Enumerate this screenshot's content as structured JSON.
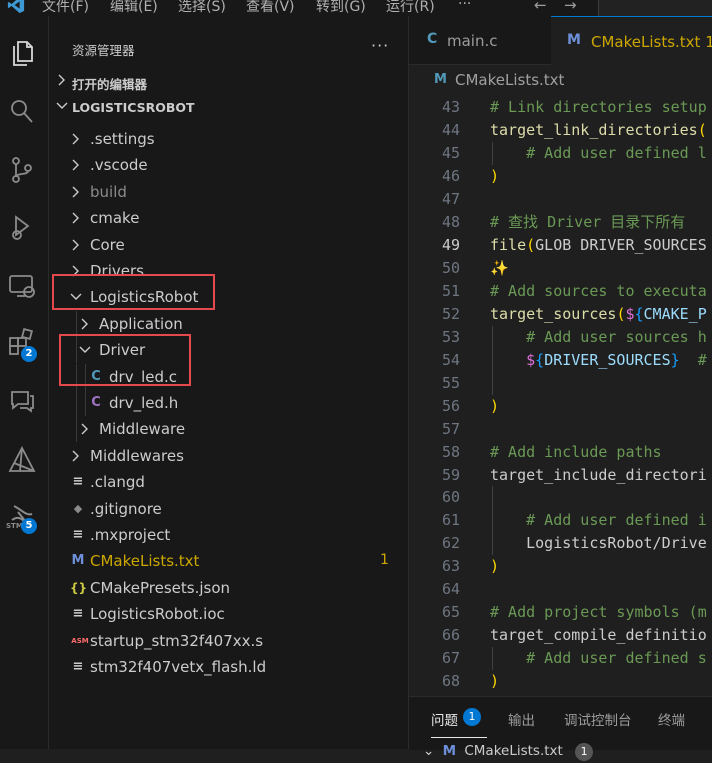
{
  "menubar": {
    "items": [
      "文件(F)",
      "编辑(E)",
      "选择(S)",
      "查看(V)",
      "转到(G)",
      "运行(R)",
      "···"
    ],
    "nav_back": "←",
    "nav_forward": "→"
  },
  "activity": {
    "extensions_badge": "2",
    "stm_label": "STM",
    "stm_badge": "5"
  },
  "sidebar": {
    "title": "资源管理器",
    "more": "···",
    "open_editors": "打开的编辑器",
    "project": "LOGISTICSROBOT"
  },
  "tree": {
    "items": [
      {
        "name": ".settings",
        "kind": "folder",
        "level": 0
      },
      {
        "name": ".vscode",
        "kind": "folder",
        "level": 0
      },
      {
        "name": "build",
        "kind": "folder",
        "level": 0,
        "dim": true
      },
      {
        "name": "cmake",
        "kind": "folder",
        "level": 0
      },
      {
        "name": "Core",
        "kind": "folder",
        "level": 0
      },
      {
        "name": "Drivers",
        "kind": "folder",
        "level": 0
      },
      {
        "name": "LogisticsRobot",
        "kind": "folder-open",
        "level": 0
      },
      {
        "name": "Application",
        "kind": "folder",
        "level": 1
      },
      {
        "name": "Driver",
        "kind": "folder-open",
        "level": 1
      },
      {
        "name": "drv_led.c",
        "kind": "c",
        "level": 2
      },
      {
        "name": "drv_led.h",
        "kind": "h",
        "level": 2
      },
      {
        "name": "Middleware",
        "kind": "folder",
        "level": 1
      },
      {
        "name": "Middlewares",
        "kind": "folder",
        "level": 0
      },
      {
        "name": ".clangd",
        "kind": "lines",
        "level": 0
      },
      {
        "name": ".gitignore",
        "kind": "git",
        "level": 0
      },
      {
        "name": ".mxproject",
        "kind": "lines",
        "level": 0
      },
      {
        "name": "CMakeLists.txt",
        "kind": "cmake",
        "level": 0,
        "badge": "1",
        "warn": true
      },
      {
        "name": "CMakePresets.json",
        "kind": "json",
        "level": 0
      },
      {
        "name": "LogisticsRobot.ioc",
        "kind": "lines",
        "level": 0
      },
      {
        "name": "startup_stm32f407xx.s",
        "kind": "asm",
        "level": 0
      },
      {
        "name": "stm32f407vetx_flash.ld",
        "kind": "lines",
        "level": 0
      }
    ]
  },
  "tabs": {
    "tab1_icon": "C",
    "tab1_label": "main.c",
    "tab2_icon": "M",
    "tab2_label": "CMakeLists.txt 1"
  },
  "breadcrumb": {
    "icon": "M",
    "label": "CMakeLists.txt"
  },
  "editor": {
    "active_line": 49,
    "lines": [
      {
        "n": 43,
        "text": "# Link directories setup"
      },
      {
        "n": 44,
        "text": "target_link_directories("
      },
      {
        "n": 45,
        "text": "    # Add user defined l"
      },
      {
        "n": 46,
        "text": ")"
      },
      {
        "n": 47,
        "text": ""
      },
      {
        "n": 48,
        "text": "# 查找 Driver 目录下所有"
      },
      {
        "n": 49,
        "text": "file(GLOB DRIVER_SOURCES"
      },
      {
        "n": 50,
        "text": "✨"
      },
      {
        "n": 51,
        "text": "# Add sources to executa"
      },
      {
        "n": 52,
        "text": "target_sources(${CMAKE_P"
      },
      {
        "n": 53,
        "text": "    # Add user sources h"
      },
      {
        "n": 54,
        "text": "    ${DRIVER_SOURCES}  #"
      },
      {
        "n": 55,
        "text": ""
      },
      {
        "n": 56,
        "text": ")"
      },
      {
        "n": 57,
        "text": ""
      },
      {
        "n": 58,
        "text": "# Add include paths"
      },
      {
        "n": 59,
        "text": "target_include_directori"
      },
      {
        "n": 60,
        "text": ""
      },
      {
        "n": 61,
        "text": "    # Add user defined i"
      },
      {
        "n": 62,
        "text": "    LogisticsRobot/Drive"
      },
      {
        "n": 63,
        "text": ")"
      },
      {
        "n": 64,
        "text": ""
      },
      {
        "n": 65,
        "text": "# Add project symbols (m"
      },
      {
        "n": 66,
        "text": "target_compile_definitio"
      },
      {
        "n": 67,
        "text": "    # Add user defined s"
      },
      {
        "n": 68,
        "text": ")"
      }
    ]
  },
  "panel": {
    "problems": "问题",
    "problems_badge": "1",
    "output": "输出",
    "debug_console": "调试控制台",
    "terminal": "终端",
    "problem_file": "CMakeLists.txt",
    "problem_file_badge": "1"
  },
  "colors": {
    "accent": "#0078d4",
    "highlight_box": "#e5484d",
    "warning": "#cca700",
    "c_file": "#519aba",
    "h_file": "#a074c4",
    "cmake_file": "#cca700",
    "json_file": "#cbcb41",
    "asm_file": "#ff6b6b"
  }
}
